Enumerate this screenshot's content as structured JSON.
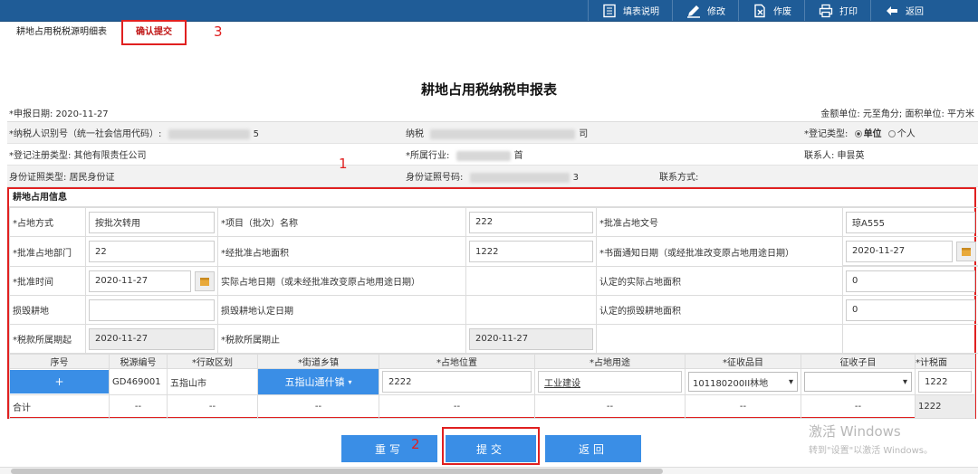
{
  "toolbar": {
    "items": [
      {
        "label": "填表说明",
        "icon": "document-list-icon"
      },
      {
        "label": "修改",
        "icon": "pencil-icon"
      },
      {
        "label": "作废",
        "icon": "void-document-icon"
      },
      {
        "label": "打印",
        "icon": "printer-icon"
      },
      {
        "label": "返回",
        "icon": "back-arrow-icon"
      }
    ]
  },
  "tabs": {
    "first": "耕地占用税税源明细表",
    "active": "确认提交"
  },
  "annotations": {
    "n1": "1",
    "n2": "2",
    "n3": "3"
  },
  "page": {
    "title": "耕地占用税纳税申报表",
    "declare_date": "*申报日期: 2020-11-27",
    "units": "金额单位: 元至角分; 面积单位: 平方米"
  },
  "taxpayer": {
    "id_label": "*纳税人识别号（统一社会信用代码）:",
    "id_tail": "5",
    "name_label": "纳税",
    "name_tail": "司",
    "reg_type_label": "*登记类型:",
    "reg_unit": "单位",
    "reg_person": "个人",
    "reg_reg_label": "*登记注册类型: 其他有限责任公司",
    "industry_label": "*所属行业:",
    "industry_tail": "首",
    "contact_label": "联系人: 申昙英",
    "idtype_label": "身份证照类型: 居民身份证",
    "idno_label": "身份证照号码:",
    "idno_tail": "3",
    "phone_label": "联系方式:"
  },
  "occupy": {
    "section_title": "耕地占用信息",
    "mode_label": "*占地方式",
    "mode_value": "按批次转用",
    "project_label": "*项目（批次）名称",
    "project_value": "222",
    "docno_label": "*批准占地文号",
    "docno_value": "琼A555",
    "dept_label": "*批准占地部门",
    "dept_value": "22",
    "area_label": "*经批准占地面积",
    "area_value": "1222",
    "notice_label": "*书面通知日期（或经批准改变原占地用途日期）",
    "notice_value": "2020-11-27",
    "approve_label": "*批准时间",
    "approve_value": "2020-11-27",
    "actual_date_label": "实际占地日期（或未经批准改变原占地用途日期）",
    "actual_area_label": "认定的实际占地面积",
    "actual_area_value": "0",
    "damage_label": "损毁耕地",
    "damage_date_label": "损毁耕地认定日期",
    "damage_area_label": "认定的损毁耕地面积",
    "damage_area_value": "0",
    "period_start_label": "*税款所属期起",
    "period_start_value": "2020-11-27",
    "period_end_label": "*税款所属期止",
    "period_end_value": "2020-11-27"
  },
  "grid": {
    "headers": [
      "序号",
      "税源编号",
      "*行政区划",
      "*街道乡镇",
      "*占地位置",
      "*占地用途",
      "*征收品目",
      "征收子目",
      "*计税面"
    ],
    "row": {
      "plus": "+",
      "source_no": "GD469001",
      "region": "五指山市",
      "street": "五指山通什镇",
      "location": "2222",
      "usage": "工业建设",
      "item": "101180200II林地",
      "subitem": "",
      "area": "1222"
    },
    "total": {
      "label": "合计",
      "dash": "--",
      "area": "1222"
    }
  },
  "buttons": {
    "reset": "重写",
    "submit": "提交",
    "back": "返回"
  },
  "watermark": {
    "line1": "激活 Windows",
    "line2": "转到\"设置\"以激活 Windows。"
  }
}
